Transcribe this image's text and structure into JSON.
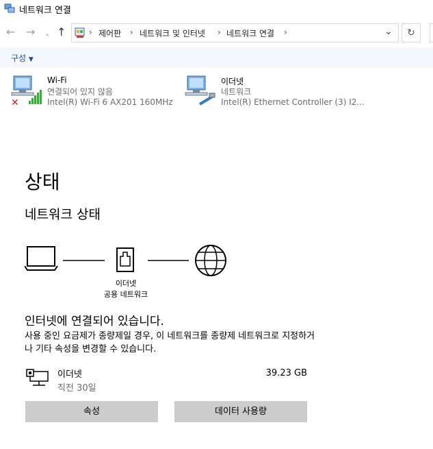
{
  "window": {
    "title": "네트워크 연결"
  },
  "address": {
    "crumbs": [
      "제어판",
      "네트워크 및 인터넷",
      "네트워크 연결"
    ]
  },
  "toolbar": {
    "organize_label": "구성"
  },
  "adapters": [
    {
      "name": "Wi-Fi",
      "status": "연결되어 있지 않음",
      "device": "Intel(R) Wi-Fi 6 AX201 160MHz"
    },
    {
      "name": "이더넷",
      "status": "네트워크",
      "device": "Intel(R) Ethernet Controller (3) I2..."
    }
  ],
  "settings": {
    "heading": "상태",
    "subheading": "네트워크 상태",
    "diagram": {
      "adapter_label": "이더넷",
      "network_label": "공용 네트워크"
    },
    "status_main": "인터넷에 연결되어 있습니다.",
    "status_desc": "사용 중인 요금제가 종량제일 경우, 이 네트워크를 종량제 네트워크로 지정하거나 기타 속성을 변경할 수 있습니다.",
    "connection": {
      "name": "이더넷",
      "sub": "직전 30일",
      "data_used": "39.23 GB"
    },
    "buttons": {
      "properties": "속성",
      "data_usage": "데이터 사용량"
    }
  }
}
